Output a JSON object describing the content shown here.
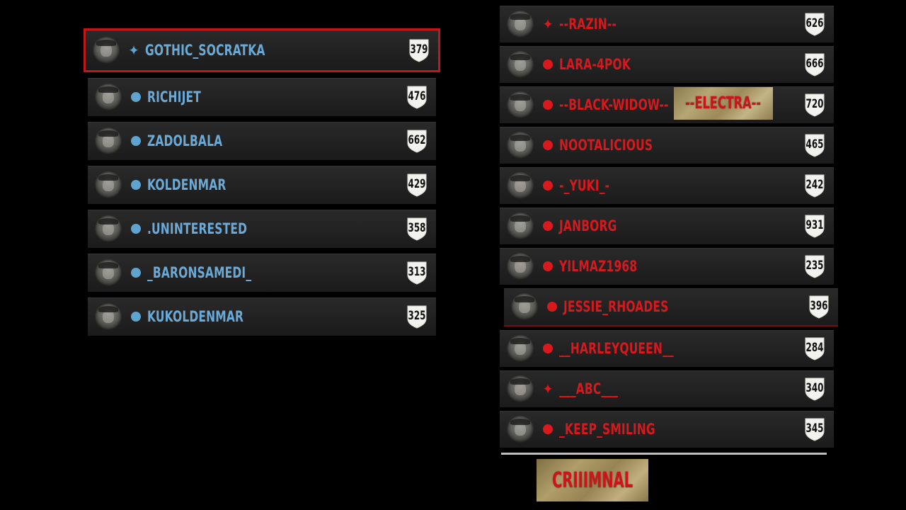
{
  "posse": {
    "players": [
      {
        "name": "GOTHIC_SOCRATKA",
        "marker": "star",
        "level": "379",
        "selected": true
      },
      {
        "name": "RICHIJET",
        "marker": "dot",
        "level": "476"
      },
      {
        "name": "ZADOLBALA",
        "marker": "dot",
        "level": "662"
      },
      {
        "name": "KOLDENMAR",
        "marker": "dot",
        "level": "429"
      },
      {
        "name": ".UNINTERESTED",
        "marker": "dot",
        "level": "358"
      },
      {
        "name": "_BARONSAMEDI_",
        "marker": "dot",
        "level": "313"
      },
      {
        "name": "KUKOLDENMAR",
        "marker": "dot",
        "level": "325"
      }
    ]
  },
  "rivals": {
    "players": [
      {
        "name": "--RAZIN--",
        "marker": "star",
        "level": "626"
      },
      {
        "name": "LARA-4POK",
        "marker": "dot",
        "level": "666"
      },
      {
        "name": "--BLACK-WIDOW--",
        "marker": "dot",
        "level": "720",
        "tag": "--ELECTRA--"
      },
      {
        "name": "NOOTALICIOUS",
        "marker": "dot",
        "level": "465"
      },
      {
        "name": "-_YUKI_-",
        "marker": "dot",
        "level": "242"
      },
      {
        "name": "JANBORG",
        "marker": "dot",
        "level": "931"
      },
      {
        "name": "YILMAZ1968",
        "marker": "dot",
        "level": "235"
      },
      {
        "name": "JESSIE_RHOADES",
        "marker": "dot",
        "level": "396",
        "highlight": true
      },
      {
        "name": "__HARLEYQUEEN__",
        "marker": "dot",
        "level": "284"
      },
      {
        "name": "___ABC___",
        "marker": "star",
        "level": "340"
      },
      {
        "name": "_KEEP_SMILING",
        "marker": "dot",
        "level": "345"
      }
    ]
  },
  "status_label": "CRIIIMNAL",
  "colors": {
    "posse_name": "#6ba9d6",
    "rival_name": "#d41a1e",
    "selection_border": "#c01818"
  },
  "icons": {
    "avatar": "player-portrait-icon",
    "level_badge": "shield-icon",
    "leader_marker": "sparkle-star-icon",
    "member_marker": "dot-icon"
  }
}
